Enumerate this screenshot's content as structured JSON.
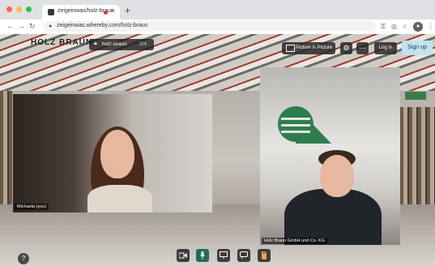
{
  "browser": {
    "tab_title": "zeigeinwas/holz-braun",
    "new_tab_symbol": "+",
    "close_symbol": "×",
    "url": "zeigeinwas.whereby.com/holz-braun",
    "traffic_lights": [
      "#fe5f57",
      "#febc2e",
      "#28c840"
    ]
  },
  "app": {
    "brand_name": "HOLZ BRAUN",
    "brand_tagline": "",
    "room": {
      "name": "holz-braun",
      "count": "2/4"
    },
    "toolbar": {
      "picture_in_picture": "Picture in Picture",
      "login": "Log in",
      "signup": "Sign up",
      "more_symbol": "···",
      "settings_symbol": "⚙"
    },
    "participants": [
      {
        "name": "Michaela (you)"
      },
      {
        "name": "Holz Braun GmbH und Co. KG"
      }
    ],
    "controls": {
      "camera_icon": "camera-icon",
      "mic_icon": "mic-icon",
      "screenshare_icon": "screenshare-icon",
      "chat_icon": "chat-icon",
      "react_icon": "hand-icon",
      "help_symbol": "?"
    },
    "colors": {
      "accent": "#226b5c",
      "signup": "#bfe3ef",
      "logo_green": "#2e7d4f"
    }
  }
}
